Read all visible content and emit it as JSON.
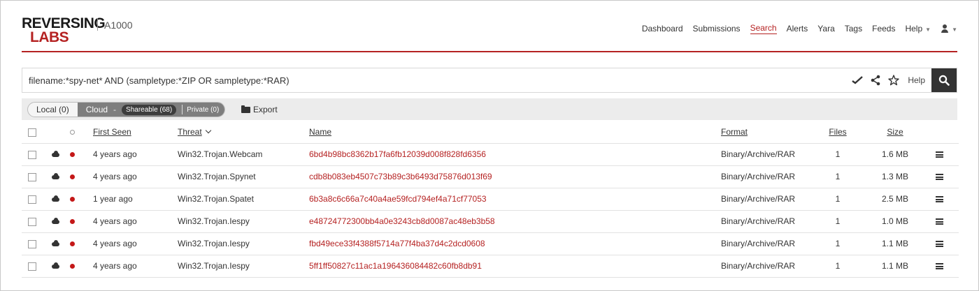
{
  "brand": {
    "logo_top": "REVERSING",
    "logo_bottom": "LABS",
    "product": "A1000",
    "accent": "#b52222"
  },
  "nav": {
    "items": [
      "Dashboard",
      "Submissions",
      "Search",
      "Alerts",
      "Yara",
      "Tags",
      "Feeds",
      "Help"
    ],
    "active": "Search",
    "user_icon": "user-icon"
  },
  "search": {
    "query": "filename:*spy-net* AND (sampletype:*ZIP OR sampletype:*RAR)",
    "help_label": "Help",
    "icons": [
      "verify-icon",
      "share-icon",
      "star-icon",
      "search-icon"
    ]
  },
  "toolbar": {
    "local_label": "Local (0)",
    "cloud_label": "Cloud",
    "cloud_sep": "-",
    "shareable_label": "Shareable (68)",
    "private_label": "Private (0)",
    "export_label": "Export"
  },
  "table": {
    "headers": {
      "first_seen": "First Seen",
      "threat": "Threat",
      "name": "Name",
      "format": "Format",
      "files": "Files",
      "size": "Size"
    },
    "rows": [
      {
        "first_seen": "4 years ago",
        "threat": "Win32.Trojan.Webcam",
        "name": "6bd4b98bc8362b17fa6fb12039d008f828fd6356",
        "format": "Binary/Archive/RAR",
        "files": "1",
        "size": "1.6 MB"
      },
      {
        "first_seen": "4 years ago",
        "threat": "Win32.Trojan.Spynet",
        "name": "cdb8b083eb4507c73b89c3b6493d75876d013f69",
        "format": "Binary/Archive/RAR",
        "files": "1",
        "size": "1.3 MB"
      },
      {
        "first_seen": "1 year ago",
        "threat": "Win32.Trojan.Spatet",
        "name": "6b3a8c6c66a7c40a4ae59fcd794ef4a71cf77053",
        "format": "Binary/Archive/RAR",
        "files": "1",
        "size": "2.5 MB"
      },
      {
        "first_seen": "4 years ago",
        "threat": "Win32.Trojan.Iespy",
        "name": "e48724772300bb4a0e3243cb8d0087ac48eb3b58",
        "format": "Binary/Archive/RAR",
        "files": "1",
        "size": "1.0 MB"
      },
      {
        "first_seen": "4 years ago",
        "threat": "Win32.Trojan.Iespy",
        "name": "fbd49ece33f4388f5714a77f4ba37d4c2dcd0608",
        "format": "Binary/Archive/RAR",
        "files": "1",
        "size": "1.1 MB"
      },
      {
        "first_seen": "4 years ago",
        "threat": "Win32.Trojan.Iespy",
        "name": "5ff1ff50827c11ac1a196436084482c60fb8db91",
        "format": "Binary/Archive/RAR",
        "files": "1",
        "size": "1.1 MB"
      }
    ]
  }
}
